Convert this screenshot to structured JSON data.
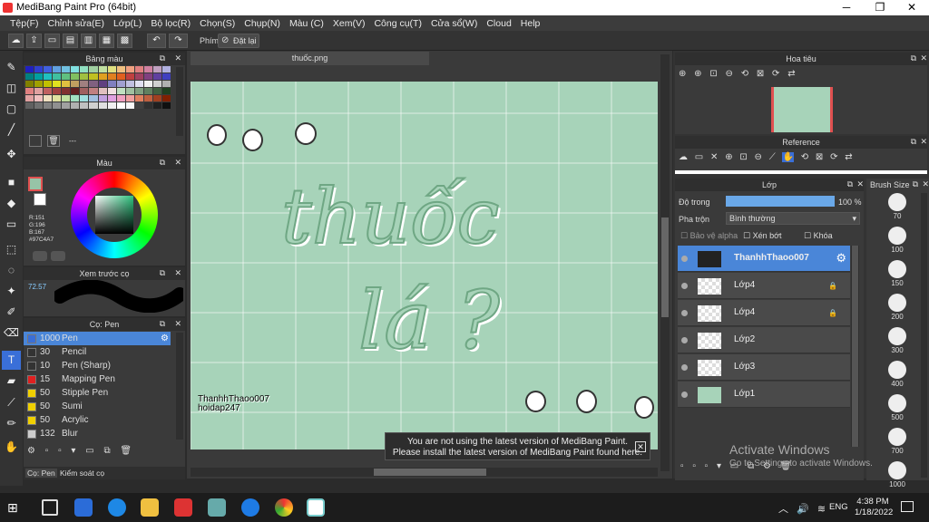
{
  "window": {
    "title": "MediBang Paint Pro (64bit)",
    "min": "─",
    "max": "❐",
    "close": "✕"
  },
  "menu": [
    "Tệp(F)",
    "Chỉnh sửa(E)",
    "Lớp(L)",
    "Bộ lọc(R)",
    "Chọn(S)",
    "Chụp(N)",
    "Màu (C)",
    "Xem(V)",
    "Công cụ(T)",
    "Cửa sổ(W)",
    "Cloud",
    "Help"
  ],
  "toolbar": {
    "shortcut_label": "Phím",
    "reset_label": "Đặt lại"
  },
  "palette": {
    "title": "Bảng màu",
    "footer": "---"
  },
  "color": {
    "title": "Màu",
    "r": "R:151",
    "g": "G:196",
    "b": "B:167",
    "hex": "#97C4A7"
  },
  "preview": {
    "title": "Xem trước cọ",
    "zoom": "72.57"
  },
  "brush": {
    "title": "Cọ: Pen",
    "items": [
      {
        "size": "1000",
        "name": "Pen",
        "color": "#3a6fd8"
      },
      {
        "size": "30",
        "name": "Pencil",
        "color": "#333333"
      },
      {
        "size": "10",
        "name": "Pen (Sharp)",
        "color": "#333333"
      },
      {
        "size": "15",
        "name": "Mapping Pen",
        "color": "#e02020"
      },
      {
        "size": "50",
        "name": "Stipple Pen",
        "color": "#f0d000"
      },
      {
        "size": "50",
        "name": "Sumi",
        "color": "#f0d000"
      },
      {
        "size": "50",
        "name": "Acrylic",
        "color": "#f0d000"
      },
      {
        "size": "132",
        "name": "Blur",
        "color": "#cccccc"
      }
    ]
  },
  "bottom_tabs": {
    "brush": "Cọ: Pen",
    "control": "Kiểm soát cọ"
  },
  "document": {
    "tab": "thuốc.png",
    "text1": "thuốc",
    "text2": "lá ?",
    "watermark1": "ThanhhThaoo007",
    "watermark2": "hoidap247"
  },
  "navigator": {
    "title": "Hoa tiêu"
  },
  "reference": {
    "title": "Reference"
  },
  "layers": {
    "title": "Lớp",
    "opacity_label": "Độ trong",
    "opacity_value": "100 %",
    "opacity": 1.0,
    "blend_label": "Pha trộn",
    "blend_value": "Bình thường",
    "protect_alpha": "Bảo vệ alpha",
    "clip": "Xén bớt",
    "lock": "Khóa",
    "items": [
      {
        "name": "ThanhhThaoo007",
        "selected": true
      },
      {
        "name": "Lớp4"
      },
      {
        "name": "Lớp4"
      },
      {
        "name": "Lớp2"
      },
      {
        "name": "Lớp3"
      },
      {
        "name": "Lớp1",
        "color": "#a7d3b9"
      }
    ]
  },
  "brush_size": {
    "title": "Brush Size",
    "sizes": [
      "70",
      "100",
      "150",
      "200",
      "300",
      "400",
      "500",
      "700",
      "1000"
    ]
  },
  "notice": {
    "line1": "You are not using the latest version of MediBang Paint.",
    "line2": "Please install the latest version of MediBang Paint found here."
  },
  "activate": {
    "line1": "Activate Windows",
    "line2": "Go to Settings to activate Windows."
  },
  "taskbar": {
    "time": "4:38 PM",
    "date": "1/18/2022",
    "lang": "ENG"
  }
}
